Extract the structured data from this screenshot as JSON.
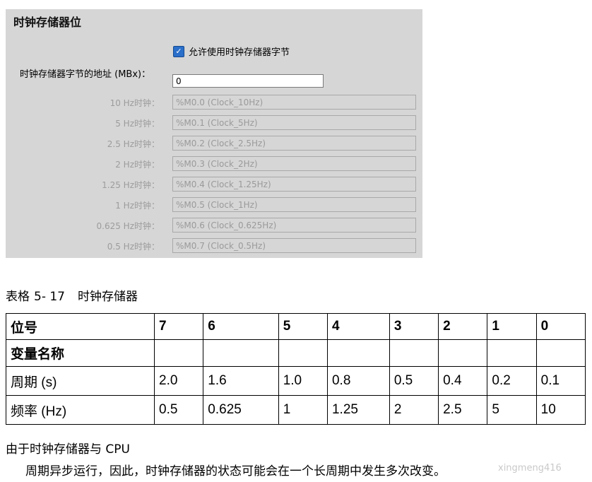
{
  "panel": {
    "title": "时钟存储器位",
    "enable_label": "允许使用时钟存储器字节",
    "checkbox_mark": "✓",
    "address_label": "时钟存储器字节的地址 (MBx)：",
    "address_value": "0",
    "clocks": [
      {
        "label": "10 Hz时钟：",
        "value": "%M0.0 (Clock_10Hz)"
      },
      {
        "label": "5 Hz时钟：",
        "value": "%M0.1 (Clock_5Hz)"
      },
      {
        "label": "2.5 Hz时钟：",
        "value": "%M0.2 (Clock_2.5Hz)"
      },
      {
        "label": "2 Hz时钟：",
        "value": "%M0.3 (Clock_2Hz)"
      },
      {
        "label": "1.25 Hz时钟：",
        "value": "%M0.4 (Clock_1.25Hz)"
      },
      {
        "label": "1 Hz时钟：",
        "value": "%M0.5 (Clock_1Hz)"
      },
      {
        "label": "0.625 Hz时钟：",
        "value": "%M0.6 (Clock_0.625Hz)"
      },
      {
        "label": "0.5 Hz时钟：",
        "value": "%M0.7 (Clock_0.5Hz)"
      }
    ]
  },
  "caption": {
    "prefix": "表格",
    "number": "5- 17",
    "title": "时钟存储器"
  },
  "table": {
    "rows": [
      [
        "位号",
        "7",
        "6",
        "5",
        "4",
        "3",
        "2",
        "1",
        "0"
      ],
      [
        "变量名称",
        "",
        "",
        "",
        "",
        "",
        "",
        "",
        ""
      ],
      [
        "周期 (s)",
        "2.0",
        "1.6",
        "1.0",
        "0.8",
        "0.5",
        "0.4",
        "0.2",
        "0.1"
      ],
      [
        "频率 (Hz)",
        "0.5",
        "0.625",
        "1",
        "1.25",
        "2",
        "2.5",
        "5",
        "10"
      ]
    ]
  },
  "footer": {
    "line1": "由于时钟存储器与 CPU",
    "line2": "周期异步运行，因此，时钟存储器的状态可能会在一个长周期中发生多次改变。"
  },
  "watermark": "xingmeng416"
}
